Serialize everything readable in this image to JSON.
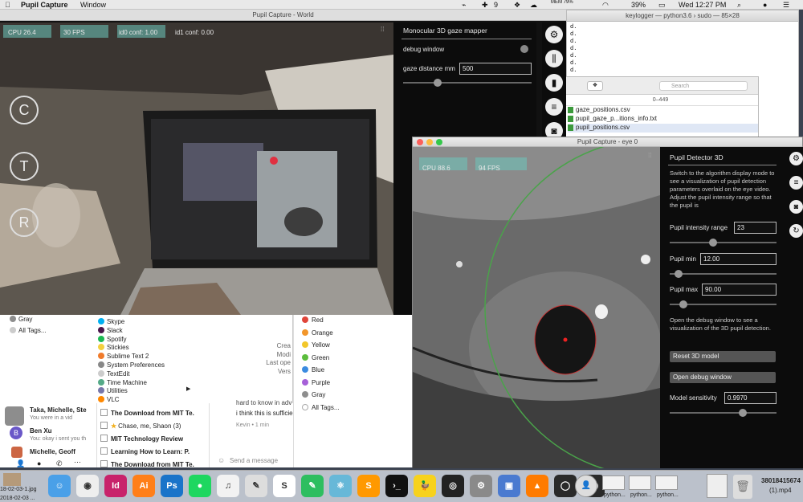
{
  "menubar": {
    "app_name": "Pupil Capture",
    "window_menu": "Window",
    "battery": "MEM\n79%",
    "tray_num": "9",
    "battery_pct": "39%",
    "clock": "Wed 12:27 PM"
  },
  "terminal": {
    "title": "keylogger — python3.6 › sudo — 85×28",
    "lines": [
      "d.",
      "d.",
      "d.",
      "d.",
      "d.",
      "d.",
      "d."
    ]
  },
  "finder": {
    "search_placeholder": "Search",
    "range": "0–449",
    "files": [
      "gaze_positions.csv",
      "pupil_gaze_p...itions_info.txt",
      "pupil_positions.csv"
    ]
  },
  "world": {
    "title": "Pupil Capture - World",
    "cpu": "CPU 26.4",
    "fps": "30 FPS",
    "id0": "id0 conf: 1.00",
    "id1": "id1 conf: 0.00",
    "btn_c": "C",
    "btn_t": "T",
    "btn_r": "R",
    "menu_title": "Monocular 3D gaze mapper",
    "debug_label": "debug window",
    "gaze_distance_label": "gaze distance mm",
    "gaze_distance_value": "500",
    "gaze_slider_level": 0.25
  },
  "applist": {
    "left_items": [
      "Gray",
      "All Tags..."
    ],
    "apps": [
      "Skype",
      "Slack",
      "Spotify",
      "Stickies",
      "Sublime Text 2",
      "System Preferences",
      "TextEdit",
      "Time Machine",
      "Utilities",
      "VLC"
    ],
    "info_labels": [
      "Crea",
      "Modi",
      "Last ope",
      "Vers"
    ]
  },
  "tags": {
    "items": [
      {
        "label": "Red",
        "color": "#e0453a"
      },
      {
        "label": "Orange",
        "color": "#f2962b"
      },
      {
        "label": "Yellow",
        "color": "#f2c72b"
      },
      {
        "label": "Green",
        "color": "#5cbd3d"
      },
      {
        "label": "Blue",
        "color": "#3b8be0"
      },
      {
        "label": "Purple",
        "color": "#a660d8"
      },
      {
        "label": "Gray",
        "color": "#8e8e8e"
      },
      {
        "label": "All Tags...",
        "color": ""
      }
    ]
  },
  "slack": {
    "m1_name": "Taka, Michelle, Ste",
    "m1_text": "You were in a vid",
    "m2_name": "Ben Xu",
    "m2_text": "You: okay i sent you th",
    "m3_name": "Michelle, Geoff"
  },
  "mail": {
    "rows": [
      "The Download from MIT Te.",
      "Chase, me, Shaon (3)",
      "MIT Technology Review",
      "Learning How to Learn: P.",
      "The Download from MIT Te."
    ]
  },
  "chat": {
    "top": "hard to know in adv",
    "msg": "i think this is sufficie",
    "meta": "Kevin • 1 min",
    "placeholder": "Send a message"
  },
  "eye": {
    "title": "Pupil Capture - eye 0",
    "cpu": "CPU 88.6",
    "fps": "94 FPS",
    "menu_title": "Pupil Detector 3D",
    "desc": "Switch to the algorithm display mode to see a visualization of pupil detection parameters overlaid on the eye video. Adjust the pupil intensity range so that the pupil is",
    "intensity_label": "Pupil intensity range",
    "intensity_value": "23",
    "min_label": "Pupil min",
    "min_value": "12.00",
    "max_label": "Pupil max",
    "max_value": "90.00",
    "debug_desc": "Open the debug window to see a visualization of the 3D pupil detection.",
    "reset_btn": "Reset 3D model",
    "open_debug_btn": "Open debug window",
    "sensitivity_label": "Model sensitivity",
    "sensitivity_value": "0.9970",
    "intensity_level": 0.4,
    "min_level": 0.05,
    "max_level": 0.1,
    "sensitivity_level": 0.7
  },
  "dock": {
    "left_file": "18-02-03-1.jpg",
    "left_file2": "2018-02-03 ...",
    "right_file": "38018415674",
    "right_file2": "(1).mp4",
    "python_labels": [
      "python...",
      "python...",
      "python..."
    ],
    "icons": [
      "finder-icon",
      "chrome-icon",
      "indesign-icon",
      "illustrator-icon",
      "photoshop-icon",
      "spotify-icon",
      "itunes-icon",
      "preview-icon",
      "slack-icon",
      "evernote-icon",
      "atom-icon",
      "sublime-icon",
      "terminal-icon",
      "cyberduck-icon",
      "github-icon",
      "system-preferences-icon",
      "photos-icon",
      "vlc-icon",
      "pupil-capture-icon",
      "pupil-player-icon"
    ]
  }
}
